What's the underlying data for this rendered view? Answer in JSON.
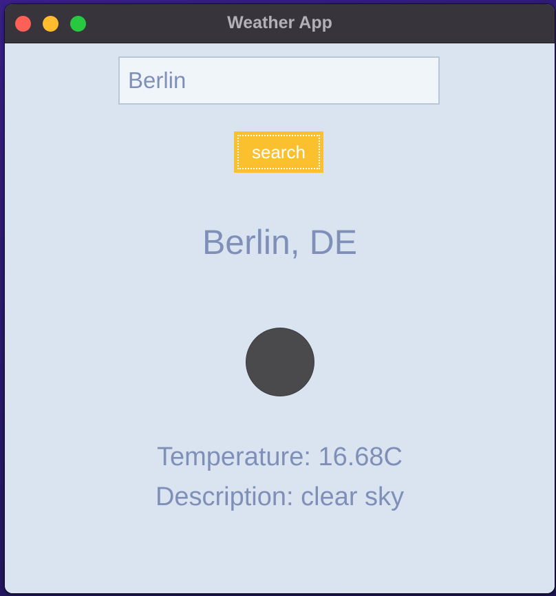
{
  "window": {
    "title": "Weather App"
  },
  "search": {
    "value": "Berlin",
    "button_label": "search"
  },
  "weather": {
    "location": "Berlin, DE",
    "icon": "weather-condition-icon",
    "temperature": "Temperature: 16.68C",
    "description": "Description: clear sky"
  },
  "colors": {
    "background": "#dae4f1",
    "text": "#7f8fb8",
    "button": "#fbc02d",
    "titlebar": "#38343c"
  }
}
